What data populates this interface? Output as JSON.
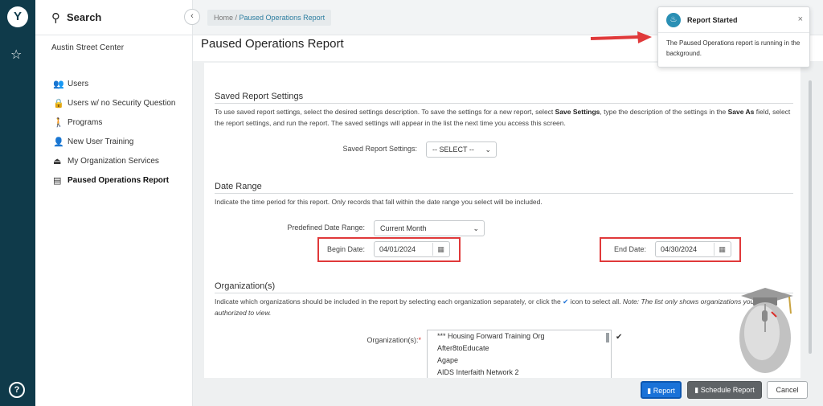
{
  "rail": {
    "logo_glyph": "Y",
    "star_icon": "☆",
    "help_icon": "?"
  },
  "sidebar": {
    "search_label": "Search",
    "agency": "Austin Street Center",
    "items": [
      {
        "label": "Users",
        "icon": "users-icon",
        "glyph": "👥"
      },
      {
        "label": "Users w/ no Security Question",
        "icon": "lock-icon",
        "glyph": "🔒"
      },
      {
        "label": "Programs",
        "icon": "person-walking-icon",
        "glyph": "🚶"
      },
      {
        "label": "New User Training",
        "icon": "person-icon",
        "glyph": "👤"
      },
      {
        "label": "My Organization Services",
        "icon": "eject-icon",
        "glyph": "⏏"
      },
      {
        "label": "Paused Operations Report",
        "icon": "report-icon",
        "glyph": "▤"
      }
    ]
  },
  "breadcrumb": {
    "home": "Home",
    "sep": " / ",
    "current": "Paused Operations Report"
  },
  "page_title": "Paused Operations Report",
  "saved_settings": {
    "title": "Saved Report Settings",
    "desc_1": "To use saved report settings, select the desired settings description. To save the settings for a new report, select ",
    "desc_b1": "Save Settings",
    "desc_2": ", type the description of the settings in the ",
    "desc_b2": "Save As",
    "desc_3": " field, select the report settings, and run the report. The saved settings will appear in the list the next time you access this screen.",
    "label": "Saved Report Settings:",
    "value": "-- SELECT --"
  },
  "date_range": {
    "title": "Date Range",
    "desc": "Indicate the time period for this report. Only records that fall within the date range you select will be included.",
    "predefined_label": "Predefined Date Range:",
    "predefined_value": "Current Month",
    "begin_label": "Begin Date:",
    "begin_value": "04/01/2024",
    "end_label": "End Date:",
    "end_value": "04/30/2024"
  },
  "organizations": {
    "title": "Organization(s)",
    "desc_1": "Indicate which organizations should be included in the report by selecting each organization separately, or click the ",
    "desc_2": " icon to select all. ",
    "desc_note": "Note: The list only shows organizations you are authorized to view.",
    "label": "Organization(s):",
    "required_mark": "*",
    "items": [
      "*** Housing Forward Training Org",
      "After8toEducate",
      "Agape",
      "AIDS Interfaith Network 2"
    ]
  },
  "buttons": {
    "report": "Report",
    "schedule": "Schedule Report",
    "cancel": "Cancel"
  },
  "toast": {
    "title": "Report Started",
    "body": "The Paused Operations report is running in the background.",
    "close": "×"
  },
  "colors": {
    "rail": "#0f3a4a",
    "primary": "#1a72d8",
    "highlight": "#e0393a",
    "toast_icon": "#2a8fb4"
  }
}
